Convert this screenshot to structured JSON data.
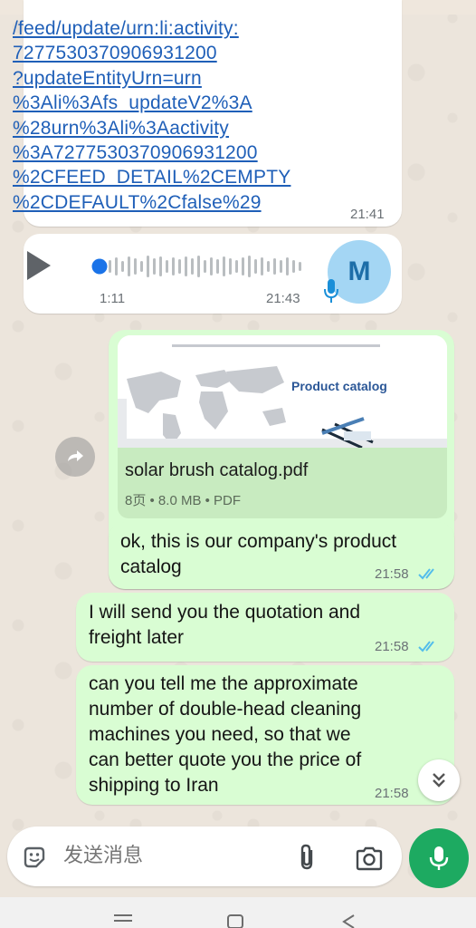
{
  "colors": {
    "incoming_bubble": "#ffffff",
    "outgoing_bubble": "#d9fdd3",
    "link": "#1f5fb8",
    "read_ticks": "#53bdeb",
    "accent_green": "#1daa61"
  },
  "messages": {
    "link": {
      "lines": [
        "/feed/update/urn:li:activity:",
        "7277530370906931200",
        "?updateEntityUrn=urn",
        "%3Ali%3Afs_updateV2%3A",
        "%28urn%3Ali%3Aactivity",
        "%3A7277530370906931200",
        "%2CFEED_DETAIL%2CEMPTY",
        "%2CDEFAULT%2Cfalse%29"
      ],
      "time": "21:41"
    },
    "voice": {
      "duration": "1:11",
      "time": "21:43",
      "avatar_letter": "M",
      "progress": 0
    },
    "document": {
      "preview_title": "Product catalog",
      "file_name": "solar brush catalog.pdf",
      "meta": "8页 • 8.0 MB • PDF"
    },
    "catalog_note": {
      "lines": [
        "ok, this is our company's product",
        "catalog"
      ],
      "time": "21:58"
    },
    "quotation": {
      "lines": [
        "I will send you the quotation and",
        "freight later"
      ],
      "time": "21:58"
    },
    "question": {
      "lines": [
        "can you tell me the approximate",
        "number of double-head cleaning",
        "machines you need, so that we",
        "can better quote you the price of",
        "shipping to Iran"
      ],
      "time": "21:58"
    }
  },
  "composer": {
    "placeholder": "发送消息",
    "icons": [
      "sticker-icon",
      "attach-icon",
      "camera-icon",
      "mic-icon"
    ]
  },
  "nav": {
    "icons": [
      "menu-icon",
      "home-icon",
      "back-icon"
    ]
  }
}
